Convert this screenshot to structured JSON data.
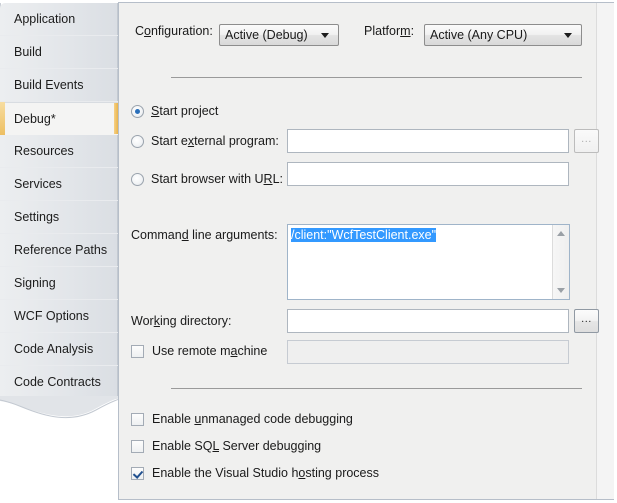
{
  "sidebar": {
    "items": [
      {
        "label": "Application",
        "selected": false
      },
      {
        "label": "Build",
        "selected": false
      },
      {
        "label": "Build Events",
        "selected": false
      },
      {
        "label": "Debug*",
        "selected": true
      },
      {
        "label": "Resources",
        "selected": false
      },
      {
        "label": "Services",
        "selected": false
      },
      {
        "label": "Settings",
        "selected": false
      },
      {
        "label": "Reference Paths",
        "selected": false
      },
      {
        "label": "Signing",
        "selected": false
      },
      {
        "label": "WCF Options",
        "selected": false
      },
      {
        "label": "Code Analysis",
        "selected": false
      },
      {
        "label": "Code Contracts",
        "selected": false
      }
    ]
  },
  "header": {
    "configuration_label_pre": "C",
    "configuration_label_accel": "o",
    "configuration_label_post": "nfiguration:",
    "configuration_value": "Active (Debug)",
    "platform_label_pre": "Platfor",
    "platform_label_accel": "m",
    "platform_label_post": ":",
    "platform_value": "Active (Any CPU)"
  },
  "start_action": {
    "options": [
      {
        "pre": "",
        "accel": "S",
        "post": "tart project",
        "selected": true,
        "has_field": false
      },
      {
        "pre": "Start e",
        "accel": "x",
        "post": "ternal program:",
        "selected": false,
        "has_field": true,
        "value": "",
        "field_enabled": false,
        "browse_label": "...",
        "browse_enabled": false
      },
      {
        "pre": "Start browser with U",
        "accel": "R",
        "post": "L:",
        "selected": false,
        "has_field": true,
        "value": "",
        "field_enabled": false
      }
    ]
  },
  "start_options": {
    "cmd_label_pre": "Comman",
    "cmd_label_accel": "d",
    "cmd_label_post": " line arguments:",
    "cmd_value": "/client:\"WcfTestClient.exe\"",
    "cmd_value_selected": true,
    "workdir_label_pre": "Wor",
    "workdir_label_accel": "k",
    "workdir_label_post": "ing directory:",
    "workdir_value": "",
    "workdir_browse_label": "...",
    "remote_label_pre": "Use remote m",
    "remote_label_accel": "a",
    "remote_label_post": "chine",
    "remote_checked": false,
    "remote_value": ""
  },
  "debugger_options": {
    "items": [
      {
        "pre": "Enable ",
        "accel": "u",
        "post": "nmanaged code debugging",
        "checked": false
      },
      {
        "pre": "Enable SQ",
        "accel": "L",
        "post": " Server debugging",
        "checked": false
      },
      {
        "pre": "Enable the Visual Studio h",
        "accel": "o",
        "post": "sting process",
        "checked": true
      }
    ]
  },
  "colors": {
    "accent_selected_tab": "#edbf62",
    "selection_highlight": "#3399ff",
    "panel_bg": "#f0f0ef",
    "radio_dot": "#2a6fba"
  }
}
